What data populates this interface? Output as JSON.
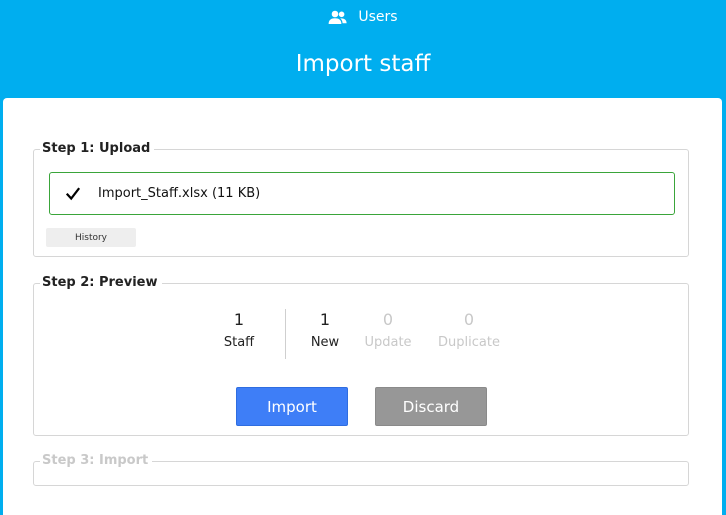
{
  "nav": {
    "users_label": "Users",
    "icon": "users-icon"
  },
  "page": {
    "title": "Import staff"
  },
  "step1": {
    "legend": "Step 1: Upload",
    "file_label": "Import_Staff.xlsx (11 KB)",
    "history_label": "History"
  },
  "step2": {
    "legend": "Step 2: Preview",
    "stats": [
      {
        "value": "1",
        "label": "Staff"
      },
      {
        "value": "1",
        "label": "New"
      },
      {
        "value": "0",
        "label": "Update"
      },
      {
        "value": "0",
        "label": "Duplicate"
      }
    ],
    "import_label": "Import",
    "discard_label": "Discard"
  },
  "step3": {
    "legend": "Step 3: Import"
  },
  "colors": {
    "header": "#00aeef",
    "primary": "#3e7ef7",
    "secondary": "#979797",
    "success": "#3aa53a"
  }
}
